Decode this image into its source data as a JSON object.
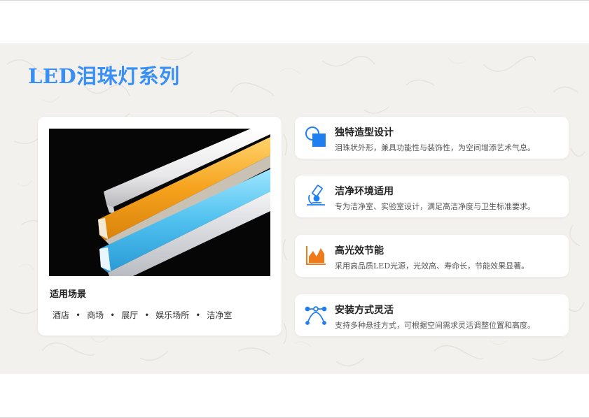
{
  "title": "LED泪珠灯系列",
  "scenes": {
    "heading": "适用场景",
    "items": [
      "酒店",
      "商场",
      "展厅",
      "娱乐场所",
      "洁净室"
    ],
    "separator": "•"
  },
  "features": [
    {
      "title": "独特造型设计",
      "desc": "泪珠状外形，兼具功能性与装饰性，为空间增添艺术气息。",
      "icon": "shape-design-icon"
    },
    {
      "title": "洁净环境适用",
      "desc": "专为洁净室、实验室设计，满足高洁净度与卫生标准要求。",
      "icon": "microscope-icon"
    },
    {
      "title": "高光效节能",
      "desc": "采用高品质LED光源，光效高、寿命长，节能效果显著。",
      "icon": "area-chart-icon"
    },
    {
      "title": "安装方式灵活",
      "desc": "支持多种悬挂方式，可根据空间需求灵活调整位置和高度。",
      "icon": "bezier-curve-icon"
    }
  ],
  "colors": {
    "accent": "#3a8ff2",
    "icon_blue": "#1f7ef0",
    "icon_orange": "#f07a1a",
    "band_background": "#f3f1ee"
  }
}
